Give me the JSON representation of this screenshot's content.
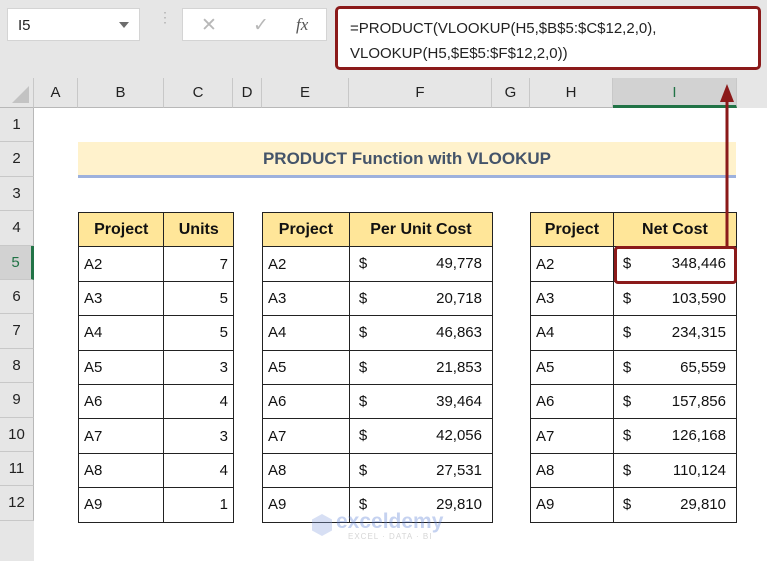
{
  "formula_bar": {
    "name_box": "I5",
    "cancel_icon": "✕",
    "enter_icon": "✓",
    "fx_label": "fx",
    "formula_line1": "=PRODUCT(VLOOKUP(H5,$B$5:$C$12,2,0),",
    "formula_line2": "VLOOKUP(H5,$E$5:$F$12,2,0))"
  },
  "columns": [
    "A",
    "B",
    "C",
    "D",
    "E",
    "F",
    "G",
    "H",
    "I"
  ],
  "rows": [
    "1",
    "2",
    "3",
    "4",
    "5",
    "6",
    "7",
    "8",
    "9",
    "10",
    "11",
    "12"
  ],
  "selected_cell": "I5",
  "title": "PRODUCT Function with VLOOKUP",
  "units_table": {
    "headers": [
      "Project",
      "Units"
    ],
    "rows": [
      [
        "A2",
        "7"
      ],
      [
        "A3",
        "5"
      ],
      [
        "A4",
        "5"
      ],
      [
        "A5",
        "3"
      ],
      [
        "A6",
        "4"
      ],
      [
        "A7",
        "3"
      ],
      [
        "A8",
        "4"
      ],
      [
        "A9",
        "1"
      ]
    ]
  },
  "cost_table": {
    "headers": [
      "Project",
      "Per Unit Cost"
    ],
    "currency": "$",
    "rows": [
      [
        "A2",
        "49,778"
      ],
      [
        "A3",
        "20,718"
      ],
      [
        "A4",
        "46,863"
      ],
      [
        "A5",
        "21,853"
      ],
      [
        "A6",
        "39,464"
      ],
      [
        "A7",
        "42,056"
      ],
      [
        "A8",
        "27,531"
      ],
      [
        "A9",
        "29,810"
      ]
    ]
  },
  "net_table": {
    "headers": [
      "Project",
      "Net Cost"
    ],
    "currency": "$",
    "rows": [
      [
        "A2",
        "348,446"
      ],
      [
        "A3",
        "103,590"
      ],
      [
        "A4",
        "234,315"
      ],
      [
        "A5",
        "65,559"
      ],
      [
        "A6",
        "157,856"
      ],
      [
        "A7",
        "126,168"
      ],
      [
        "A8",
        "110,124"
      ],
      [
        "A9",
        "29,810"
      ]
    ]
  },
  "watermark": {
    "name": "exceldemy",
    "tagline": "EXCEL · DATA · BI"
  },
  "colors": {
    "accent": "#8b1a1a",
    "header_fill": "#ffe699",
    "title_fill": "#fff2cc",
    "select_green": "#217346"
  }
}
